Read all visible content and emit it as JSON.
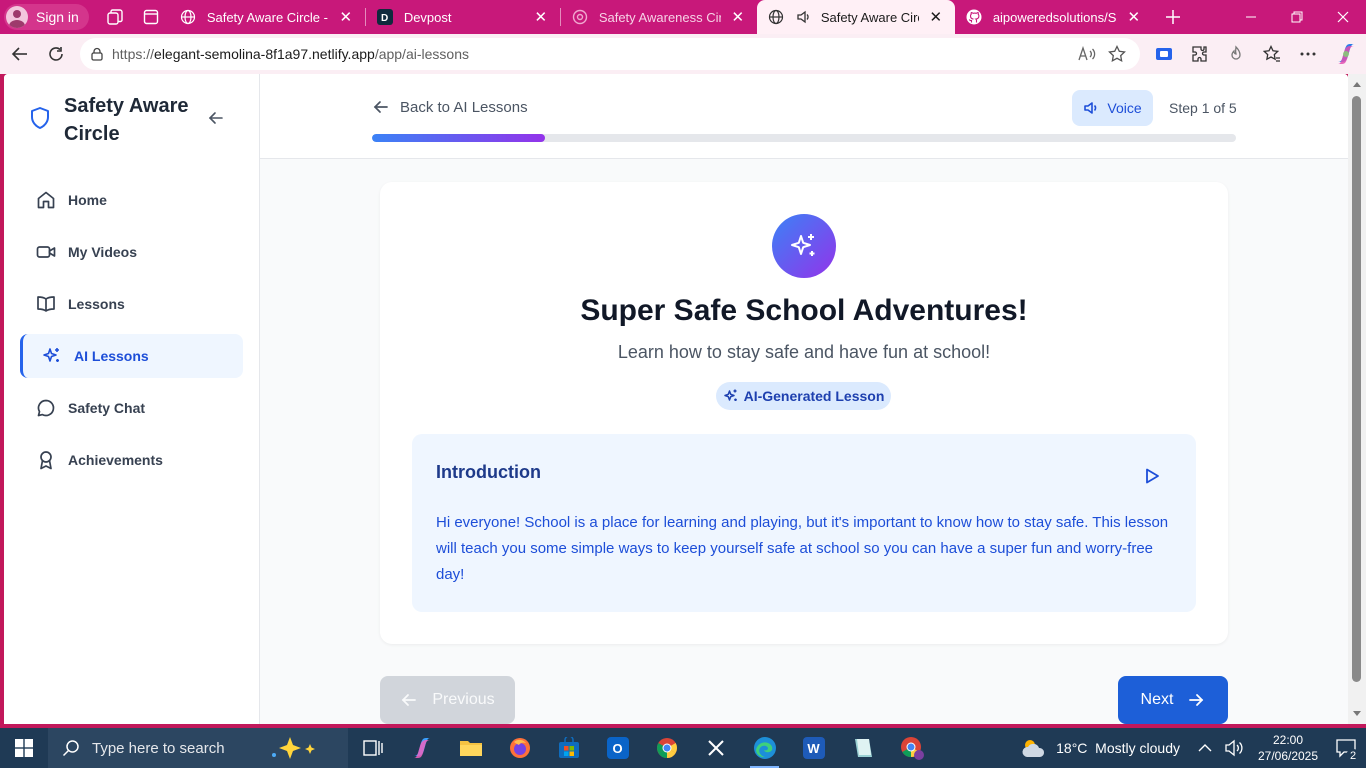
{
  "browser": {
    "profile_label": "Sign in",
    "tabs": [
      {
        "title": "Safety Aware Circle - Inte",
        "icon": "globe-icon"
      },
      {
        "title": "Devpost",
        "icon": "devpost-icon"
      },
      {
        "title": "Safety Awareness Circle D",
        "icon": "site-icon"
      },
      {
        "title": "Safety Aware Circle -",
        "icon": "globe-icon",
        "active": true
      },
      {
        "title": "aipoweredsolutions/Safet",
        "icon": "github-icon"
      }
    ],
    "url_prefix": "https://",
    "url_host": "elegant-semolina-8f1a97.netlify.app",
    "url_path": "/app/ai-lessons"
  },
  "sidebar": {
    "brand": "Safety Aware Circle",
    "items": [
      {
        "label": "Home",
        "icon": "home-icon"
      },
      {
        "label": "My Videos",
        "icon": "video-icon"
      },
      {
        "label": "Lessons",
        "icon": "book-icon"
      },
      {
        "label": "AI Lessons",
        "icon": "sparkles-icon",
        "active": true
      },
      {
        "label": "Safety Chat",
        "icon": "chat-icon"
      },
      {
        "label": "Achievements",
        "icon": "award-icon"
      }
    ]
  },
  "header": {
    "back_label": "Back to AI Lessons",
    "voice_label": "Voice",
    "step_label": "Step 1 of 5",
    "progress_fraction": 0.2
  },
  "lesson": {
    "title": "Super Safe School Adventures!",
    "subtitle": "Learn how to stay safe and have fun at school!",
    "tag": "AI-Generated Lesson",
    "section_title": "Introduction",
    "section_body": "Hi everyone! School is a place for learning and playing, but it's important to know how to stay safe. This lesson will teach you some simple ways to keep yourself safe at school so you can have a super fun and worry-free day!"
  },
  "nav": {
    "previous_label": "Previous",
    "next_label": "Next"
  },
  "taskbar": {
    "search_placeholder": "Type here to search",
    "weather": "18°C  Mostly cloudy",
    "time": "22:00",
    "date": "27/06/2025",
    "notification_count": "2"
  },
  "colors": {
    "brand_blue": "#1d5fd8",
    "browser_accent": "#c8187a",
    "progress_start": "#3b82f6",
    "progress_end": "#9333ea"
  }
}
